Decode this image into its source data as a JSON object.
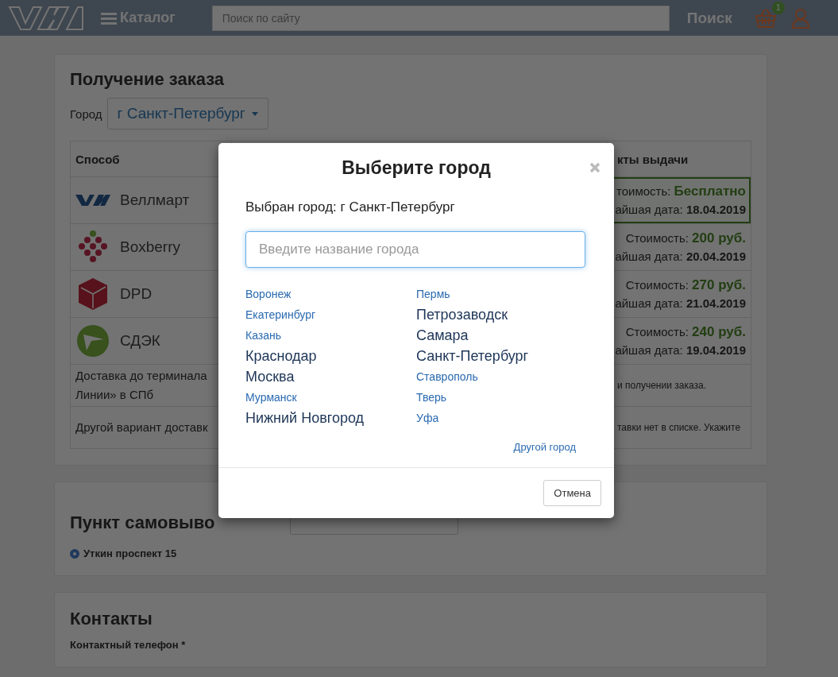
{
  "header": {
    "catalog_label": "Каталог",
    "search": {
      "placeholder": "Поиск по сайту"
    },
    "search_button": "Поиск",
    "cart_badge": "1"
  },
  "order_section": {
    "title": "Получение заказа",
    "city_label": "Город",
    "city_select": "г Санкт-Петербург",
    "table": {
      "column_1": "Способ",
      "column_3": "кты выдачи",
      "rows": [
        {
          "kind": "vellmart",
          "name": "Веллмарт",
          "cost": "тоимость: **Бесплатно**",
          "date": "айшая дата: **18.04.2019**",
          "selected": true
        },
        {
          "kind": "boxberry",
          "name": "Boxberry",
          "cost": "Стоимость: **200 руб.**",
          "date": "айшая дата: **20.04.2019**",
          "selected": false
        },
        {
          "kind": "dpd",
          "name": "DPD",
          "cost": "Стоимость: **270 руб.**",
          "date": "айшая дата: **21.04.2019**",
          "selected": false
        },
        {
          "kind": "cdek",
          "name": "СДЭК",
          "cost": "Стоимость: **240 руб.**",
          "date": "айшая дата: **19.04.2019**",
          "selected": false
        }
      ],
      "notes": [
        {
          "left_lines": [
            "Доставка до терминала",
            "Линии» в СПб"
          ],
          "right": "и получении заказа."
        },
        {
          "left_lines": [
            "Другой вариант доставк"
          ],
          "right": "тавки нет в списке. Укажите"
        }
      ]
    }
  },
  "pickup_section": {
    "title": "Пункт самовыво",
    "options": [
      {
        "label": "Уткин проспект 15",
        "selected": true
      }
    ]
  },
  "contacts_section": {
    "title": "Контакты",
    "phone_label": "Контактный телефон *"
  },
  "modal": {
    "title": "Выберите город",
    "current": "Выбран город: г Санкт-Петербург",
    "search": {
      "placeholder": "Введите название города"
    },
    "cities": [
      [
        {
          "name": "Воронеж",
          "major": false
        },
        {
          "name": "Екатеринбург",
          "major": false
        },
        {
          "name": "Казань",
          "major": false
        },
        {
          "name": "Краснодар",
          "major": true
        },
        {
          "name": "Москва",
          "major": true
        },
        {
          "name": "Мурманск",
          "major": false
        },
        {
          "name": "Нижний Новгород",
          "major": true
        }
      ],
      [
        {
          "name": "Пермь",
          "major": false
        },
        {
          "name": "Петрозаводск",
          "major": true
        },
        {
          "name": "Самара",
          "major": true
        },
        {
          "name": "Санкт-Петербург",
          "major": true
        },
        {
          "name": "Ставрополь",
          "major": false
        },
        {
          "name": "Тверь",
          "major": false
        },
        {
          "name": "Уфа",
          "major": false
        }
      ]
    ],
    "other_city": "Другой город",
    "cancel_button": "Отмена"
  }
}
